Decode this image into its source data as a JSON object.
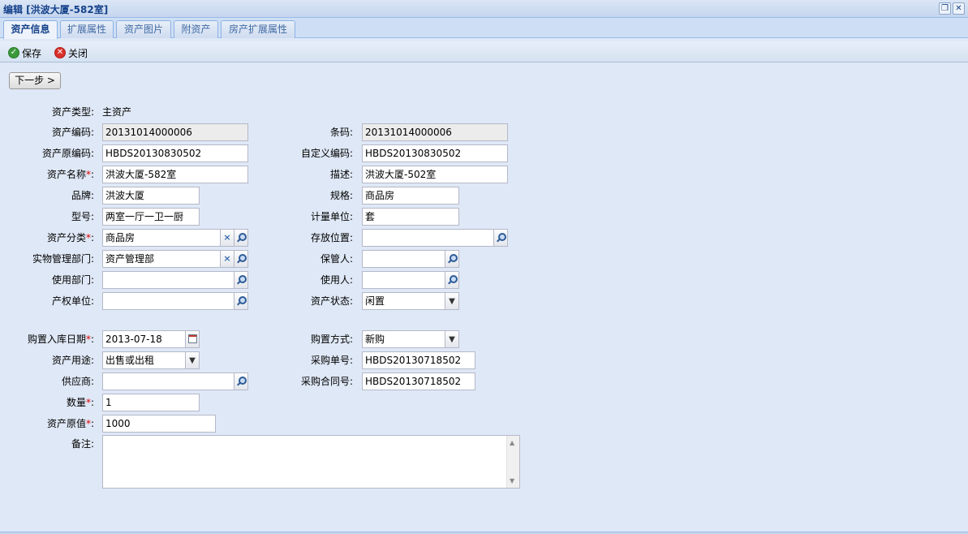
{
  "window": {
    "title": "编辑 [洪波大厦-582室]"
  },
  "tabs": [
    {
      "label": "资产信息"
    },
    {
      "label": "扩展属性"
    },
    {
      "label": "资产图片"
    },
    {
      "label": "附资产"
    },
    {
      "label": "房产扩展属性"
    }
  ],
  "toolbar": {
    "save_label": "保存",
    "close_label": "关闭"
  },
  "next_button": "下一步 >",
  "form": {
    "asset_type_label": "资产类型:",
    "asset_type_value": "主资产",
    "asset_code_label": "资产编码:",
    "asset_code_value": "20131014000006",
    "barcode_label": "条码:",
    "barcode_value": "20131014000006",
    "orig_code_label": "资产原编码:",
    "orig_code_value": "HBDS20130830502",
    "custom_code_label": "自定义编码:",
    "custom_code_value": "HBDS20130830502",
    "asset_name_label": "资产名称",
    "asset_name_value": "洪波大厦-582室",
    "desc_label": "描述:",
    "desc_value": "洪波大厦-502室",
    "brand_label": "品牌:",
    "brand_value": "洪波大厦",
    "spec_label": "规格:",
    "spec_value": "商品房",
    "model_label": "型号:",
    "model_value": "两室一厅一卫一厨",
    "unit_label": "计量单位:",
    "unit_value": "套",
    "category_label": "资产分类",
    "category_value": "商品房",
    "storage_label": "存放位置:",
    "storage_value": "",
    "mgmt_dept_label": "实物管理部门:",
    "mgmt_dept_value": "资产管理部",
    "custodian_label": "保管人:",
    "custodian_value": "",
    "use_dept_label": "使用部门:",
    "use_dept_value": "",
    "user_label": "使用人:",
    "user_value": "",
    "owner_unit_label": "产权单位:",
    "owner_unit_value": "",
    "status_label": "资产状态:",
    "status_value": "闲置",
    "purchase_date_label": "购置入库日期",
    "purchase_date_value": "2013-07-18",
    "purchase_method_label": "购置方式:",
    "purchase_method_value": "新购",
    "usage_label": "资产用途:",
    "usage_value": "出售或出租",
    "po_number_label": "采购单号:",
    "po_number_value": "HBDS20130718502",
    "supplier_label": "供应商:",
    "supplier_value": "",
    "contract_label": "采购合同号:",
    "contract_value": "HBDS20130718502",
    "quantity_label": "数量",
    "quantity_value": "1",
    "orig_value_label": "资产原值",
    "orig_value_value": "1000",
    "remarks_label": "备注:",
    "remarks_value": "",
    "required_mark": "*",
    "colon": ":"
  }
}
